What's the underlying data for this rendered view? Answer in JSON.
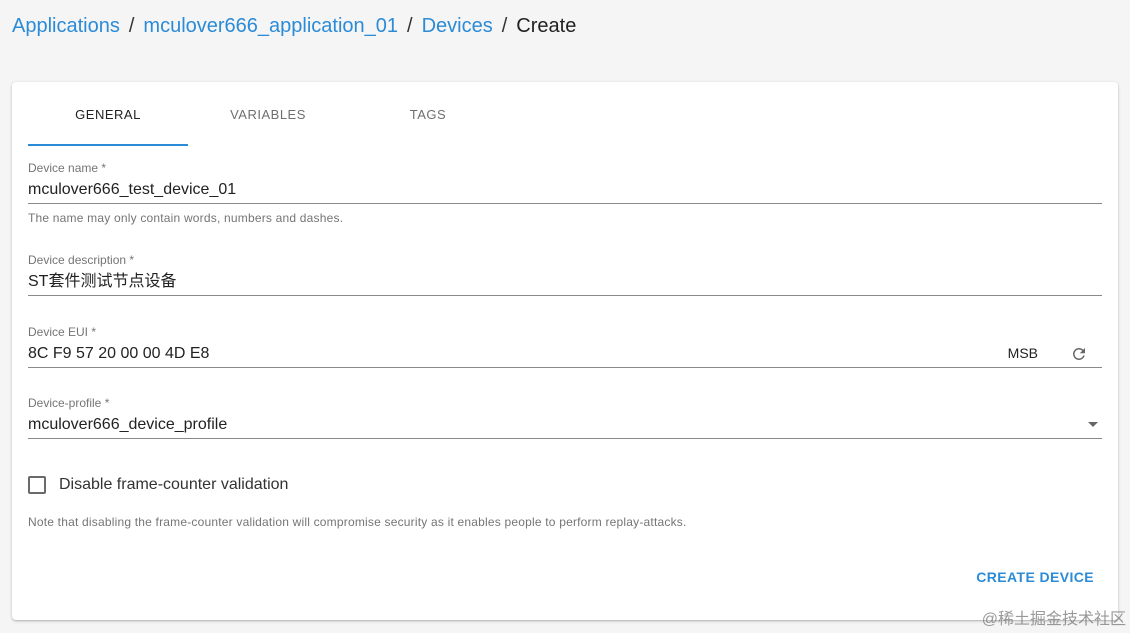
{
  "breadcrumb": {
    "items": [
      "Applications",
      "mculover666_application_01",
      "Devices"
    ],
    "separator": "/",
    "current": "Create"
  },
  "tabs": [
    {
      "label": "GENERAL",
      "active": true
    },
    {
      "label": "VARIABLES",
      "active": false
    },
    {
      "label": "TAGS",
      "active": false
    }
  ],
  "form": {
    "device_name": {
      "label": "Device name *",
      "value": "mculover666_test_device_01",
      "helper": "The name may only contain words, numbers and dashes."
    },
    "device_description": {
      "label": "Device description *",
      "value": "ST套件测试节点设备"
    },
    "device_eui": {
      "label": "Device EUI *",
      "value": "8C F9 57 20 00 00 4D E8",
      "byte_order": "MSB",
      "refresh_icon": "refresh-icon"
    },
    "device_profile": {
      "label": "Device-profile *",
      "value": "mculover666_device_profile",
      "dropdown_icon": "dropdown-arrow-icon"
    },
    "frame_counter": {
      "label": "Disable frame-counter validation",
      "checked": false,
      "note": "Note that disabling the frame-counter validation will compromise security as it enables people to perform replay-attacks."
    },
    "submit_label": "CREATE DEVICE"
  },
  "watermark": "@稀土掘金技术社区",
  "colors": {
    "accent": "#2c8bd6",
    "background": "#f5f5f5",
    "card": "#ffffff"
  }
}
